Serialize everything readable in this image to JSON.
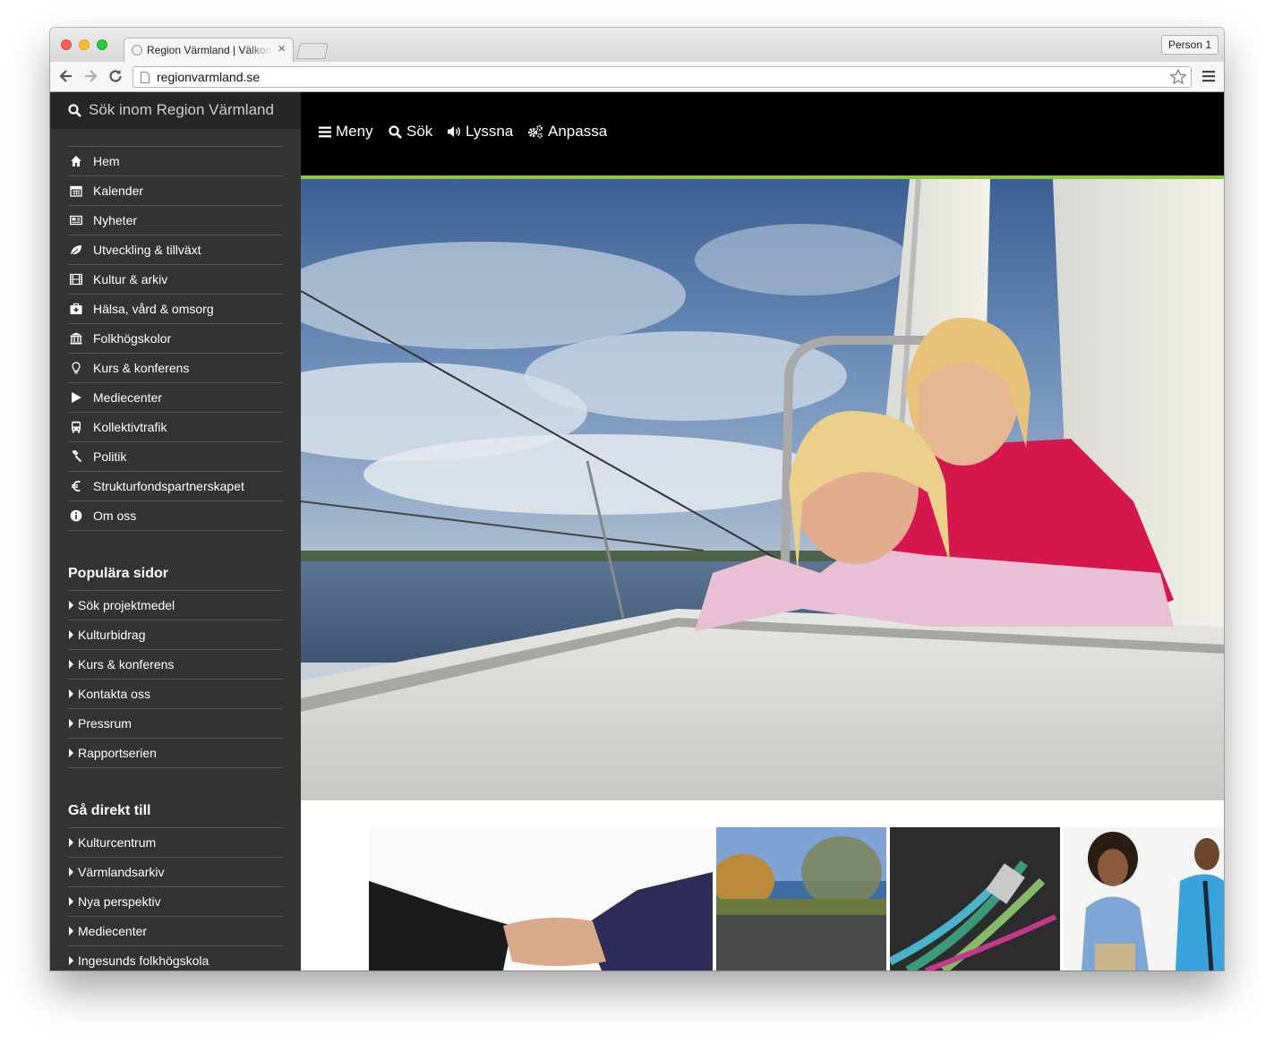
{
  "browser": {
    "tab_title": "Region Värmland | Välkommen",
    "tab_close": "×",
    "profile_label": "Person 1",
    "url": "regionvarmland.se"
  },
  "sidebar": {
    "search_placeholder": "Sök inom Region Värmland",
    "nav_items": [
      {
        "label": "Hem",
        "icon": "home-icon"
      },
      {
        "label": "Kalender",
        "icon": "calendar-icon"
      },
      {
        "label": "Nyheter",
        "icon": "newspaper-icon"
      },
      {
        "label": "Utveckling & tillväxt",
        "icon": "leaf-icon"
      },
      {
        "label": "Kultur & arkiv",
        "icon": "film-icon"
      },
      {
        "label": "Hälsa, vård & omsorg",
        "icon": "medkit-icon"
      },
      {
        "label": "Folkhögskolor",
        "icon": "institution-icon"
      },
      {
        "label": "Kurs & konferens",
        "icon": "lightbulb-icon"
      },
      {
        "label": "Mediecenter",
        "icon": "play-icon"
      },
      {
        "label": "Kollektivtrafik",
        "icon": "bus-icon"
      },
      {
        "label": "Politik",
        "icon": "gavel-icon"
      },
      {
        "label": "Strukturfondspartnerskapet",
        "icon": "euro-icon"
      },
      {
        "label": "Om oss",
        "icon": "info-icon"
      }
    ],
    "popular_heading": "Populära sidor",
    "popular_items": [
      "Sök projektmedel",
      "Kulturbidrag",
      "Kurs & konferens",
      "Kontakta oss",
      "Pressrum",
      "Rapportserien"
    ],
    "direct_heading": "Gå direkt till",
    "direct_items": [
      "Kulturcentrum",
      "Värmlandsarkiv",
      "Nya perspektiv",
      "Mediecenter",
      "Ingesunds folkhögskola"
    ]
  },
  "topnav": {
    "menu": "Meny",
    "search": "Sök",
    "listen": "Lyssna",
    "customize": "Anpassa"
  },
  "colors": {
    "accent_green": "#8fc640",
    "sidebar_bg": "#333333",
    "topbar_bg": "#000000"
  }
}
